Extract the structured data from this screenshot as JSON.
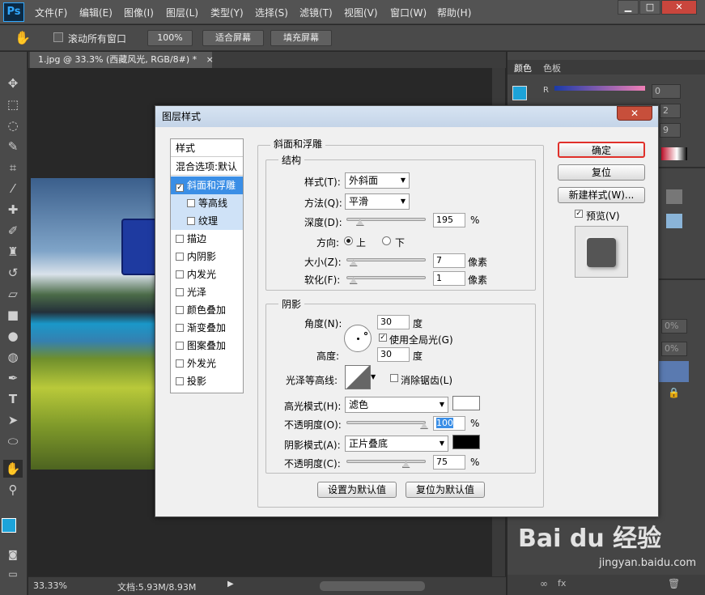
{
  "app": {
    "logo": "Ps"
  },
  "menu": [
    "文件(F)",
    "编辑(E)",
    "图像(I)",
    "图层(L)",
    "类型(Y)",
    "选择(S)",
    "滤镜(T)",
    "视图(V)",
    "窗口(W)",
    "帮助(H)"
  ],
  "window_controls": [
    "▁",
    "□",
    "✕"
  ],
  "options": {
    "scroll_all": "滚动所有窗口",
    "zoom_100": "100%",
    "fit_screen": "适合屏幕",
    "fill_screen": "填充屏幕"
  },
  "document": {
    "tab_title": "1.jpg @ 33.3% (西藏风光, RGB/8#) *",
    "zoom": "33.33%",
    "doc_size": "文档:5.93M/8.93M"
  },
  "panels": {
    "color_tab": "颜色",
    "swatches_tab": "色板",
    "channel_r": "R",
    "r_value": "0",
    "g_value": "2",
    "b_value": "9",
    "opacity_1": "0%",
    "opacity_2": "0%"
  },
  "dialog": {
    "title": "图层样式",
    "close": "✕",
    "list_header": "样式",
    "blend_default": "混合选项:默认",
    "effects": [
      {
        "label": "斜面和浮雕",
        "checked": "✓"
      },
      {
        "label": "等高线",
        "checked": ""
      },
      {
        "label": "纹理",
        "checked": ""
      },
      {
        "label": "描边",
        "checked": ""
      },
      {
        "label": "内阴影",
        "checked": ""
      },
      {
        "label": "内发光",
        "checked": ""
      },
      {
        "label": "光泽",
        "checked": ""
      },
      {
        "label": "颜色叠加",
        "checked": ""
      },
      {
        "label": "渐变叠加",
        "checked": ""
      },
      {
        "label": "图案叠加",
        "checked": ""
      },
      {
        "label": "外发光",
        "checked": ""
      },
      {
        "label": "投影",
        "checked": ""
      }
    ],
    "bevel": {
      "title": "斜面和浮雕",
      "structure": "结构",
      "style_label": "样式(T):",
      "style_value": "外斜面",
      "technique_label": "方法(Q):",
      "technique_value": "平滑",
      "depth_label": "深度(D):",
      "depth_value": "195",
      "depth_unit": "%",
      "direction_label": "方向:",
      "dir_up": "上",
      "dir_down": "下",
      "size_label": "大小(Z):",
      "size_value": "7",
      "size_unit": "像素",
      "soften_label": "软化(F):",
      "soften_value": "1",
      "soften_unit": "像素",
      "depth_level": 0.12,
      "size_level": 0.03,
      "soften_level": 0.03
    },
    "shading": {
      "title": "阴影",
      "angle_label": "角度(N):",
      "angle_value": "30",
      "angle_unit": "度",
      "global_light": "使用全局光(G)",
      "global_checked": "✓",
      "altitude_label": "高度:",
      "altitude_value": "30",
      "altitude_unit": "度",
      "gloss_label": "光泽等高线:",
      "antialias": "消除锯齿(L)",
      "highlight_label": "高光模式(H):",
      "highlight_value": "滤色",
      "highlight_color": "#ffffff",
      "hl_opacity_label": "不透明度(O):",
      "hl_opacity_value": "100",
      "hl_opacity_unit": "%",
      "shadow_label": "阴影模式(A):",
      "shadow_value": "正片叠底",
      "shadow_color": "#000000",
      "sh_opacity_label": "不透明度(C):",
      "sh_opacity_value": "75",
      "sh_opacity_unit": "%",
      "hl_level": 1.0,
      "sh_level": 0.75
    },
    "buttons": {
      "make_default": "设置为默认值",
      "reset_default": "复位为默认值",
      "ok": "确定",
      "reset": "复位",
      "new_style": "新建样式(W)...",
      "preview": "预览(V)",
      "preview_checked": "✓"
    }
  },
  "watermark": {
    "brand": "Bai du 经验",
    "url": "jingyan.baidu.com"
  }
}
